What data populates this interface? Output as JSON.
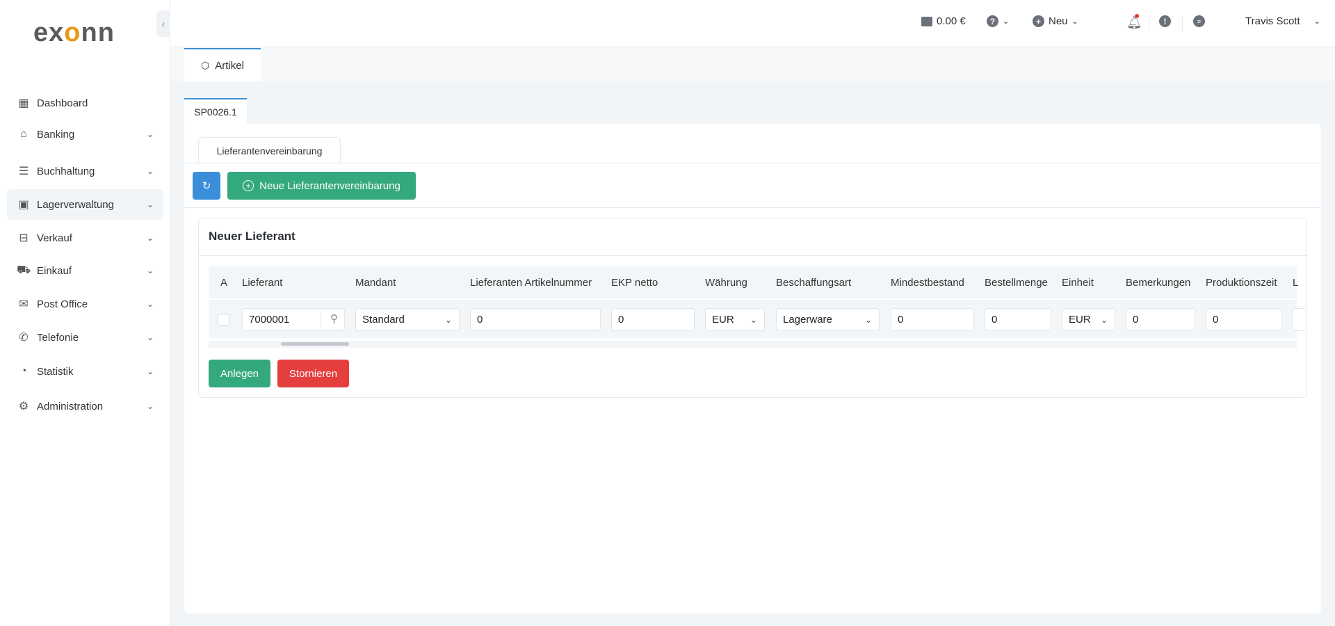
{
  "logo": {
    "text_a": "ex",
    "text_b": "o",
    "text_c": "nn"
  },
  "sidebar": {
    "collapse_icon": "chevron-left",
    "items": [
      {
        "label": "Dashboard",
        "icon": "grid-icon",
        "glyph": "▦",
        "chevron": false
      },
      {
        "label": "Banking",
        "icon": "bank-icon",
        "glyph": "⌂",
        "chevron": true
      },
      {
        "label": "Buchhaltung",
        "icon": "ledger-icon",
        "glyph": "☰",
        "chevron": true
      },
      {
        "label": "Lagerverwaltung",
        "icon": "warehouse-icon",
        "glyph": "▣",
        "chevron": true,
        "active": true
      },
      {
        "label": "Verkauf",
        "icon": "store-icon",
        "glyph": "⊟",
        "chevron": true
      },
      {
        "label": "Einkauf",
        "icon": "cart-icon",
        "glyph": "⛟",
        "chevron": true
      },
      {
        "label": "Post Office",
        "icon": "mail-icon",
        "glyph": "✉",
        "chevron": true
      },
      {
        "label": "Telefonie",
        "icon": "phone-icon",
        "glyph": "✆",
        "chevron": true
      },
      {
        "label": "Statistik",
        "icon": "pie-chart-icon",
        "glyph": "◔",
        "chevron": true
      },
      {
        "label": "Administration",
        "icon": "gear-icon",
        "glyph": "⚙",
        "chevron": true
      }
    ]
  },
  "topbar": {
    "balance": "0.00 €",
    "new_label": "Neu",
    "user": "Travis Scott",
    "notification_dot_color": "#e53935"
  },
  "tabs": {
    "main": "Artikel",
    "record": "SP0026.1",
    "inner": "Lieferantenvereinbarung"
  },
  "toolbar": {
    "new_agreement": "Neue Lieferantenvereinbarung",
    "refresh_color": "#3b8fd9",
    "green": "#35a97e"
  },
  "card": {
    "title": "Neuer Lieferant",
    "columns": [
      "A",
      "Lieferant",
      "Mandant",
      "Lieferanten Artikelnummer",
      "EKP netto",
      "Währung",
      "Beschaffungsart",
      "Mindestbestand",
      "Bestellmenge",
      "Einheit",
      "Bemerkungen",
      "Produktionszeit",
      "L"
    ],
    "row": {
      "lieferant": "7000001",
      "mandant": "Standard",
      "artikelnummer": "0",
      "ekp": "0",
      "waehrung": "EUR",
      "beschaffungsart": "Lagerware",
      "mindestbestand": "0",
      "bestellmenge": "0",
      "einheit": "EUR",
      "bemerkungen": "0",
      "produktionszeit": "0"
    },
    "save": "Anlegen",
    "cancel": "Stornieren",
    "cancel_color": "#e53e3e"
  }
}
